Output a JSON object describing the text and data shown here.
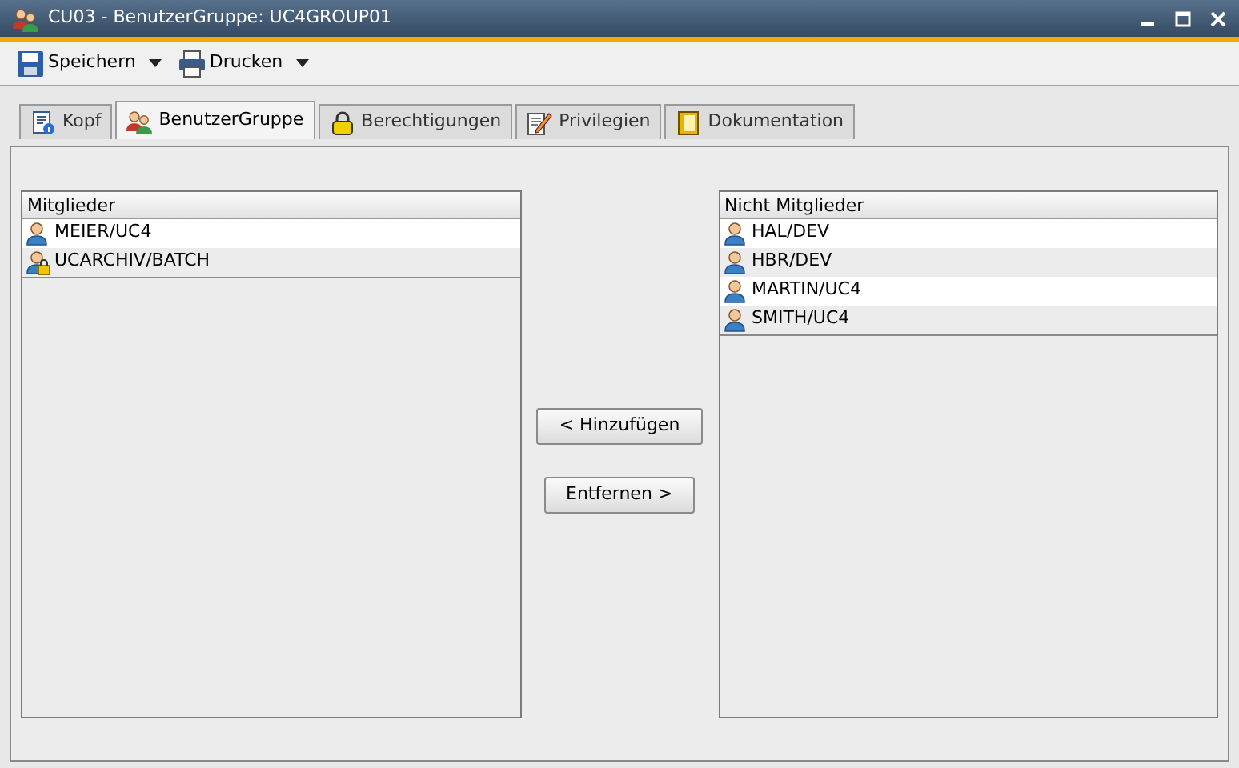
{
  "window": {
    "title": "CU03 - BenutzerGruppe: UC4GROUP01"
  },
  "toolbar": [
    {
      "label": "Speichern",
      "kind": "save"
    },
    {
      "label": "Drucken",
      "kind": "print"
    }
  ],
  "tabs": [
    {
      "label": "Kopf",
      "kind": "info",
      "selected": false
    },
    {
      "label": "BenutzerGruppe",
      "kind": "group",
      "selected": true
    },
    {
      "label": "Berechtigungen",
      "kind": "lock",
      "selected": false
    },
    {
      "label": "Privilegien",
      "kind": "pen",
      "selected": false
    },
    {
      "label": "Dokumentation",
      "kind": "doc",
      "selected": false
    }
  ],
  "members": {
    "header": "Mitglieder",
    "items": [
      {
        "label": "MEIER/UC4",
        "kind": "user"
      },
      {
        "label": "UCARCHIV/BATCH",
        "kind": "locked-user"
      }
    ]
  },
  "buttons": {
    "add": "< Hinzufügen",
    "remove": "Entfernen >"
  },
  "non_members": {
    "header": "Nicht Mitglieder",
    "items": [
      {
        "label": "HAL/DEV",
        "kind": "user"
      },
      {
        "label": "HBR/DEV",
        "kind": "user"
      },
      {
        "label": "MARTIN/UC4",
        "kind": "user"
      },
      {
        "label": "SMITH/UC4",
        "kind": "user"
      }
    ]
  }
}
